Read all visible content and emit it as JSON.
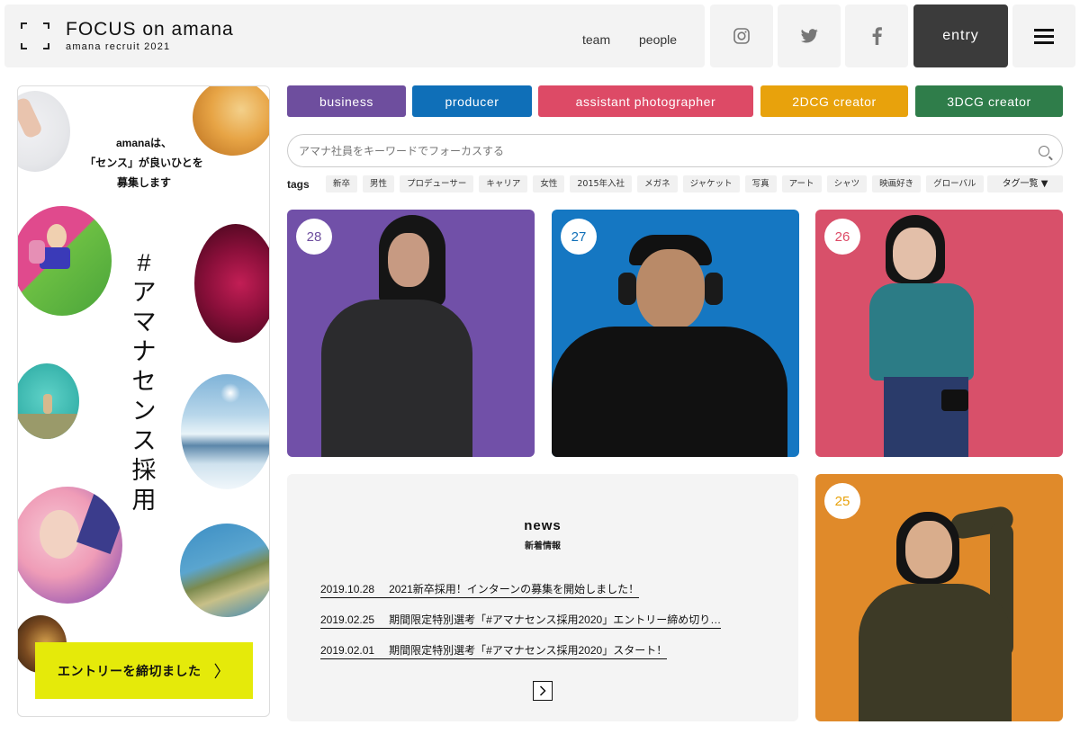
{
  "header": {
    "title": "FOCUS on amana",
    "subtitle": "amana recruit 2021",
    "nav": {
      "team": "team",
      "people": "people"
    },
    "entry_label": "entry",
    "social_icons": [
      "instagram-icon",
      "twitter-icon",
      "facebook-icon"
    ],
    "menu_icon": "hamburger-menu-icon"
  },
  "banner": {
    "lines": [
      "amanaは、",
      "「センス」が良いひとを",
      "募集します"
    ],
    "vertical_chars": [
      "#",
      "ア",
      "マ",
      "ナ",
      "セ",
      "ン",
      "ス",
      "採",
      "用"
    ],
    "closed_button": "エントリーを締切ました",
    "closed_button_color": "#e5ea0a"
  },
  "categories": [
    {
      "label": "business",
      "color": "#6e4e9e"
    },
    {
      "label": "producer",
      "color": "#0f6fb8"
    },
    {
      "label": "assistant photographer",
      "color": "#dd4a66"
    },
    {
      "label": "2DCG creator",
      "color": "#e8a20c"
    },
    {
      "label": "3DCG creator",
      "color": "#2f7d4a"
    }
  ],
  "search": {
    "placeholder": "アマナ社員をキーワードでフォーカスする"
  },
  "tags": {
    "label": "tags",
    "items": [
      "新卒",
      "男性",
      "プロデューサー",
      "キャリア",
      "女性",
      "2015年入社",
      "メガネ",
      "ジャケット",
      "写真",
      "アート",
      "シャツ",
      "映画好き",
      "グローバル"
    ],
    "list_button": "タグ一覧 ▼"
  },
  "people": [
    {
      "number": "28",
      "bg": "#7150a8",
      "accent": "#6e4e9e"
    },
    {
      "number": "27",
      "bg": "#1577c2",
      "accent": "#0f6fb8"
    },
    {
      "number": "26",
      "bg": "#d8506a",
      "accent": "#dd4a66"
    },
    {
      "number": "25",
      "bg": "#e08a2a",
      "accent": "#e8a20c"
    }
  ],
  "news": {
    "title": "news",
    "subtitle": "新着情報",
    "items": [
      {
        "date": "2019.10.28",
        "text": "2021新卒採用！インターンの募集を開始しました！"
      },
      {
        "date": "2019.02.25",
        "text": "期間限定特別選考「#アマナセンス採用2020」エントリー締め切り…"
      },
      {
        "date": "2019.02.01",
        "text": "期間限定特別選考「#アマナセンス採用2020」スタート！"
      }
    ],
    "more_icon": "chevron-right-icon"
  }
}
